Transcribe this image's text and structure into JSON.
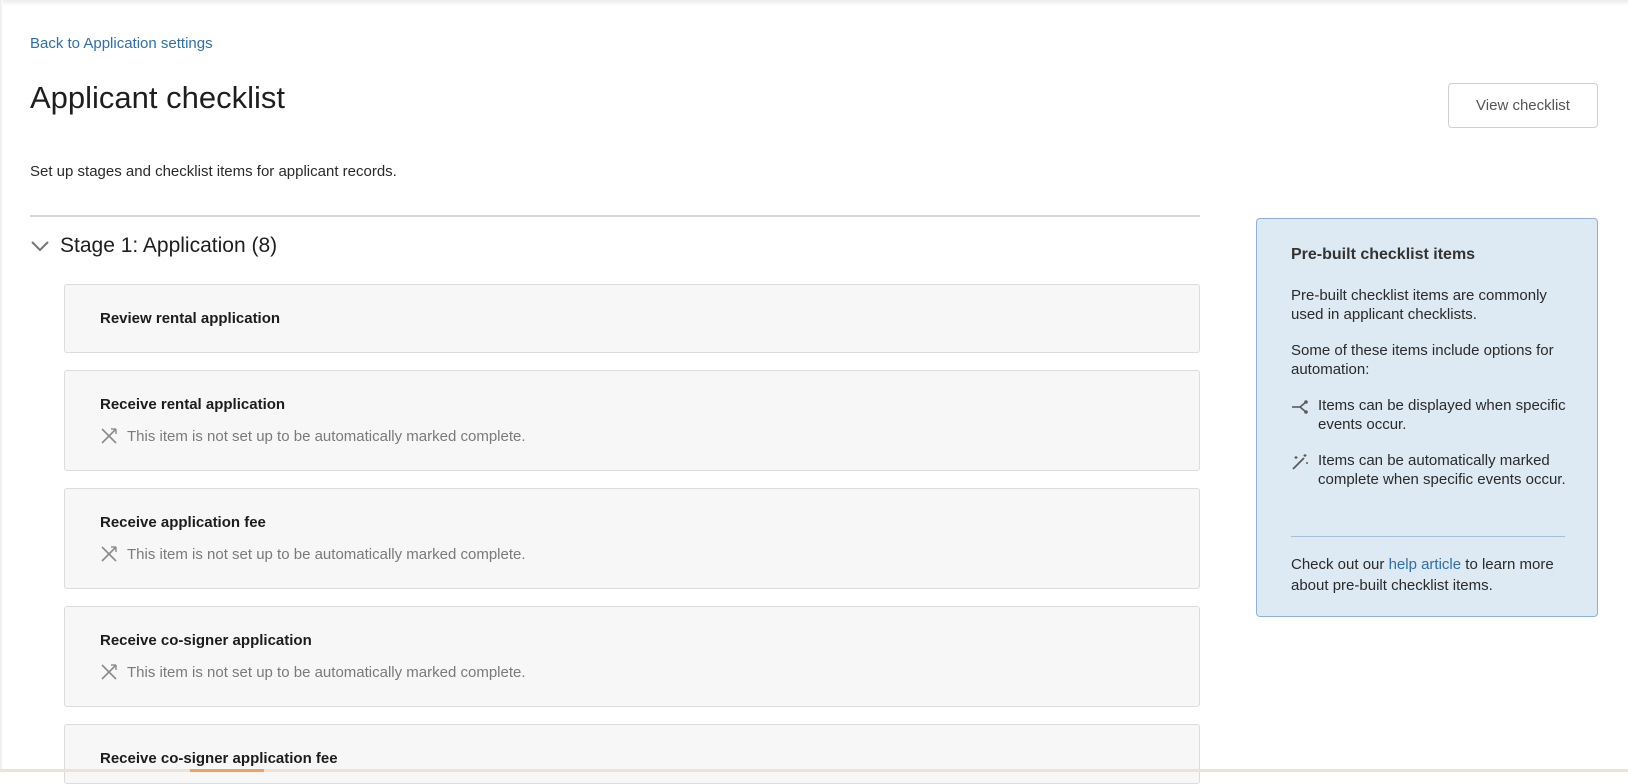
{
  "header": {
    "back_link": "Back to Application settings",
    "title": "Applicant checklist",
    "view_button": "View checklist",
    "subtitle": "Set up stages and checklist items for applicant records."
  },
  "stage": {
    "title": "Stage 1: Application (8)",
    "icon": "chevron-down-icon",
    "expanded": true,
    "items": [
      {
        "title": "Review rental application",
        "note": ""
      },
      {
        "title": "Receive rental application",
        "note": "This item is not set up to be automatically marked complete."
      },
      {
        "title": "Receive application fee",
        "note": "This item is not set up to be automatically marked complete."
      },
      {
        "title": "Receive co-signer application",
        "note": "This item is not set up to be automatically marked complete."
      },
      {
        "title": "Receive co-signer application fee",
        "note": ""
      }
    ]
  },
  "panel": {
    "title": "Pre-built checklist items",
    "intro": "Pre-built checklist items are commonly used in applicant checklists.",
    "automation": "Some of these items include options for automation:",
    "features": [
      {
        "icon": "branch-icon",
        "text": "Items can be displayed when specific events occur."
      },
      {
        "icon": "magic-wand-icon",
        "text": "Items can be automatically marked complete when specific events occur."
      }
    ],
    "footer_before": "Check out our",
    "help_link": "help article",
    "footer_after": "to learn more about pre-built checklist items."
  },
  "colors": {
    "link": "#2f6fa5",
    "panel_bg": "#dde9f3",
    "panel_border": "#8fb2d4",
    "item_bg": "#f7f7f7",
    "accent_bar": "#f4a259"
  }
}
